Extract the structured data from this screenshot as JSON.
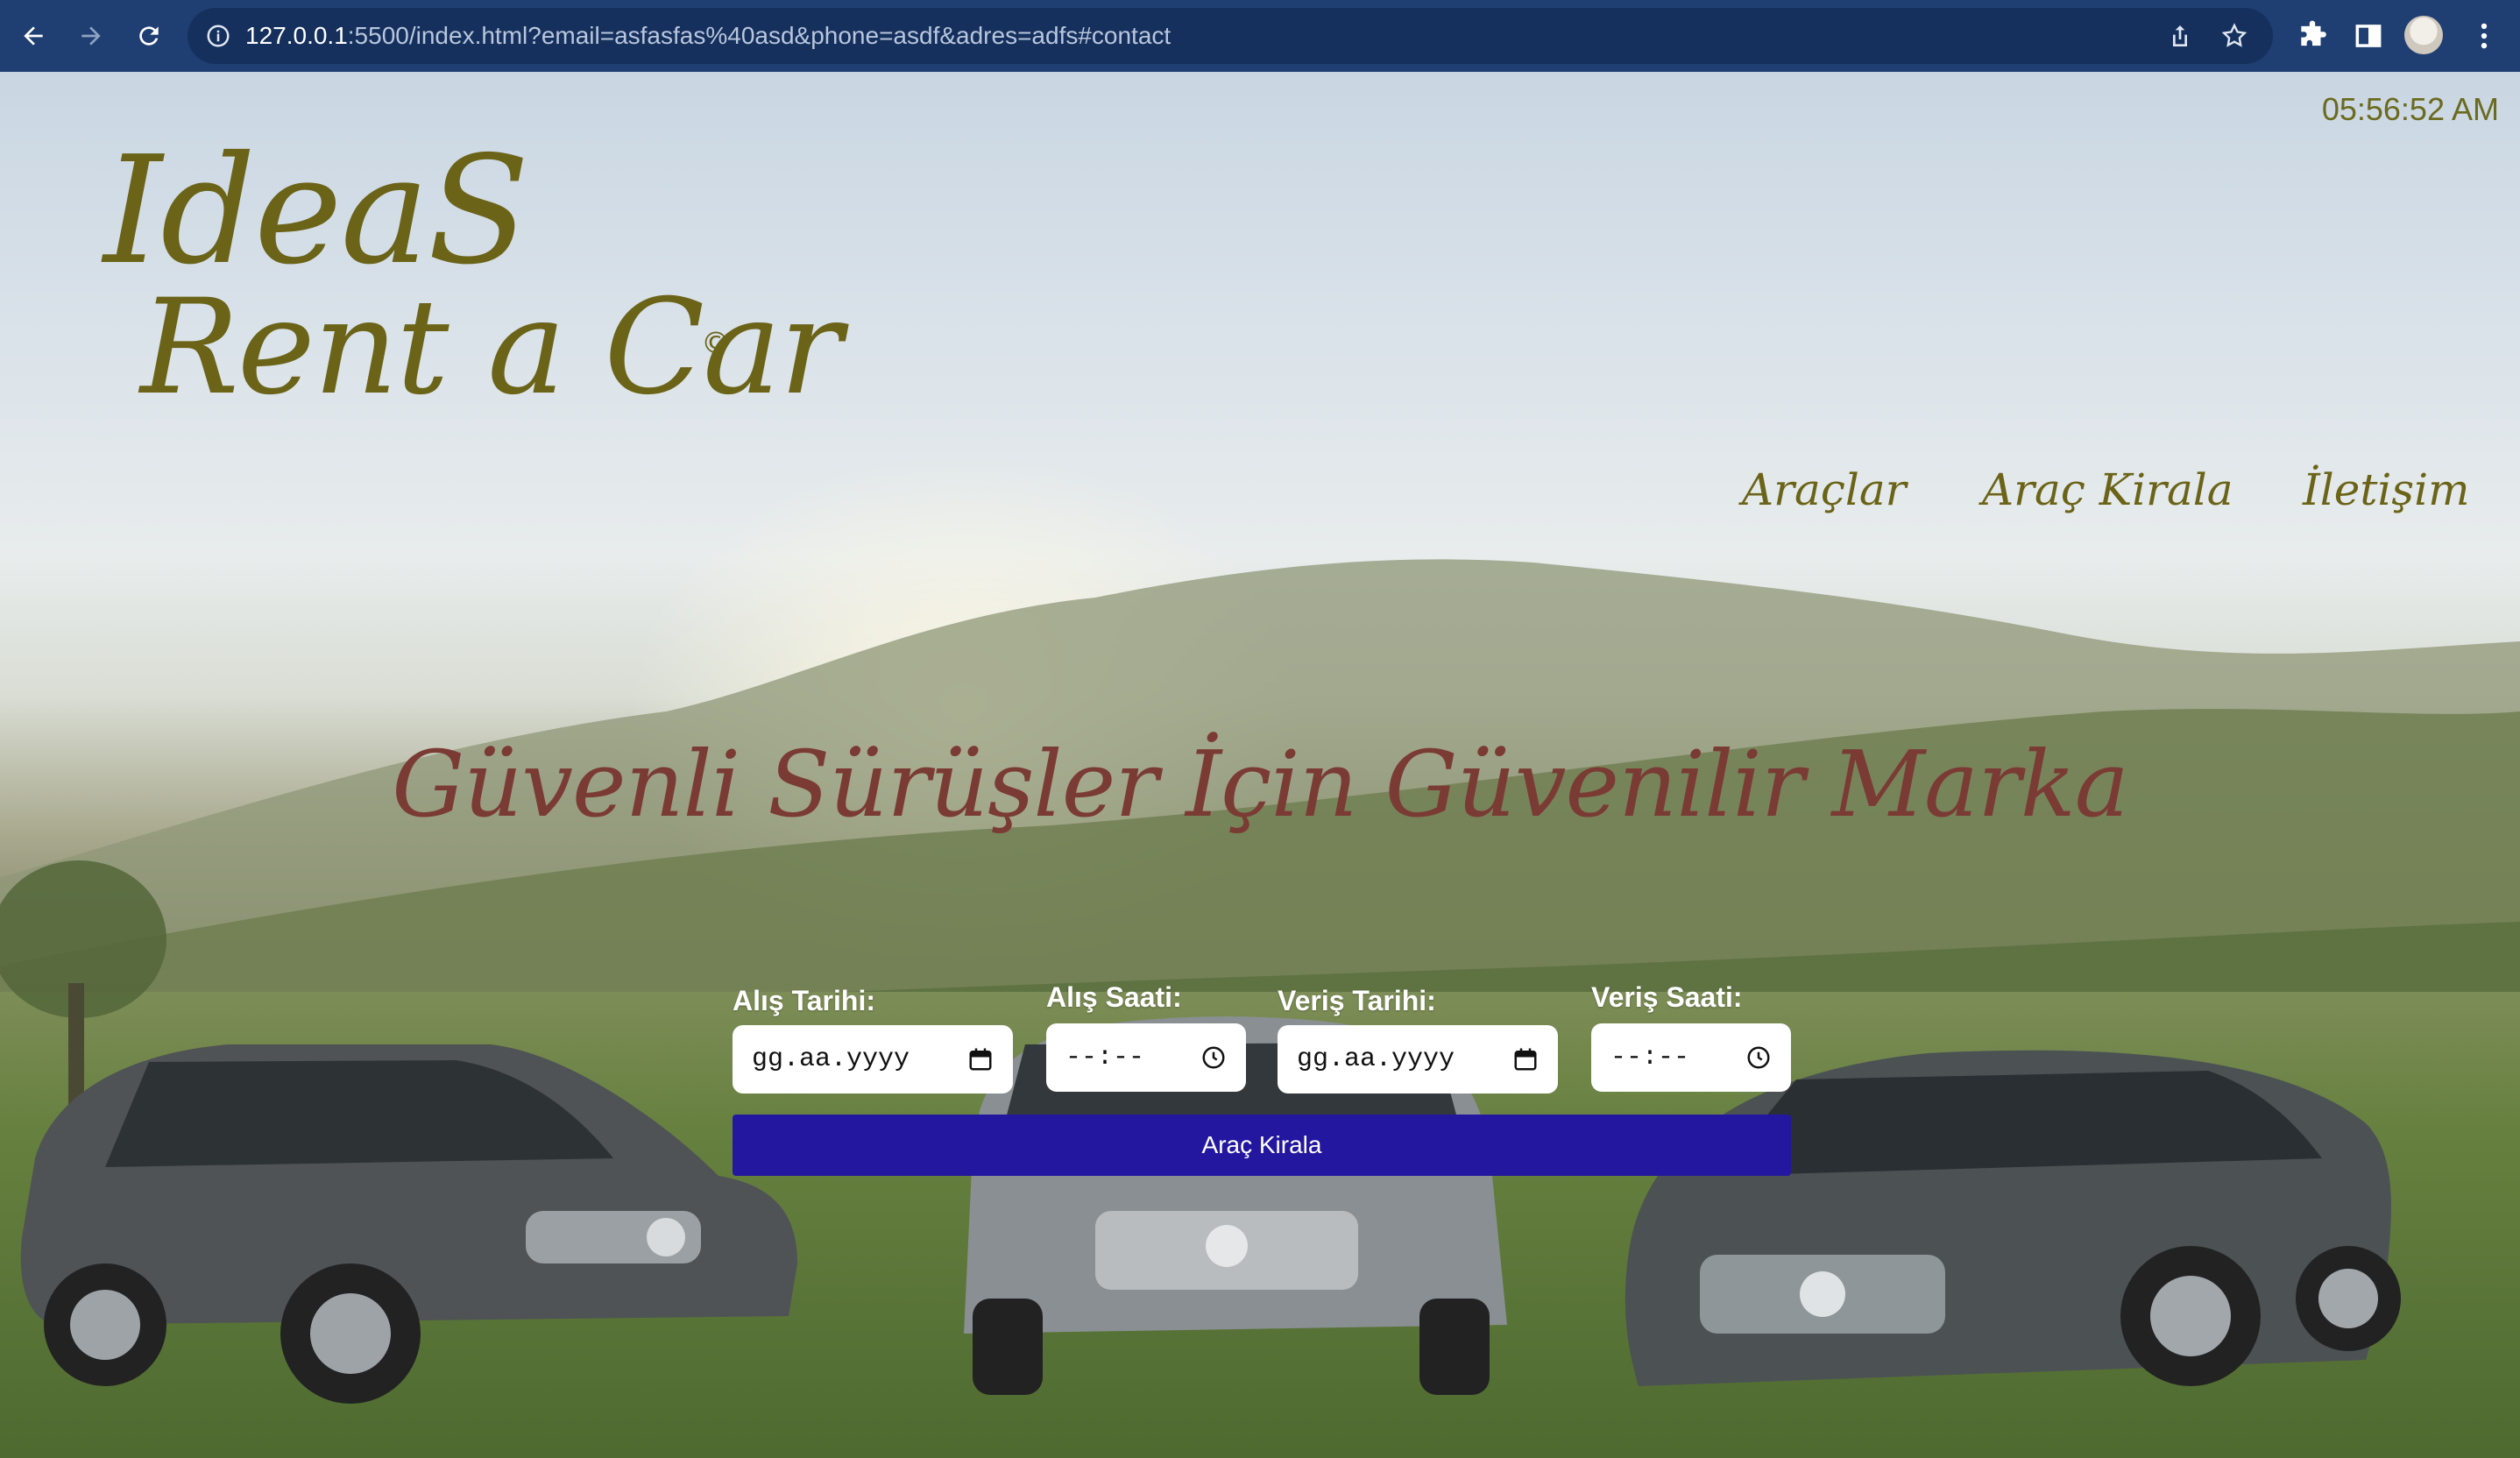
{
  "browser": {
    "url_host": "127.0.0.1",
    "url_rest": ":5500/index.html?email=asfasfas%40asd&phone=asdf&adres=adfs#contact"
  },
  "header": {
    "clock": "05:56:52 AM",
    "logo_line1": "IdeaS",
    "logo_line2": "Rent a Car",
    "copyright": "©"
  },
  "nav": {
    "items": [
      "Araçlar",
      "Araç Kirala",
      "İletişim"
    ]
  },
  "hero": {
    "slogan": "Güvenli Sürüşler İçin Güvenilir Marka"
  },
  "form": {
    "pickup_date_label": "Alış Tarihi:",
    "pickup_time_label": "Alış Saati:",
    "return_date_label": "Veriş Tarihi:",
    "return_time_label": "Veriş Saati:",
    "pickup_date_value": "gg.aa.yyyy",
    "pickup_time_value": "--:--",
    "return_date_value": "gg.aa.yyyy",
    "return_time_value": "--:--",
    "submit_label": "Araç Kirala"
  },
  "colors": {
    "chrome": "#1f3f73",
    "logo": "#6b6418",
    "slogan": "#7b3b35",
    "button": "#2317a0"
  }
}
